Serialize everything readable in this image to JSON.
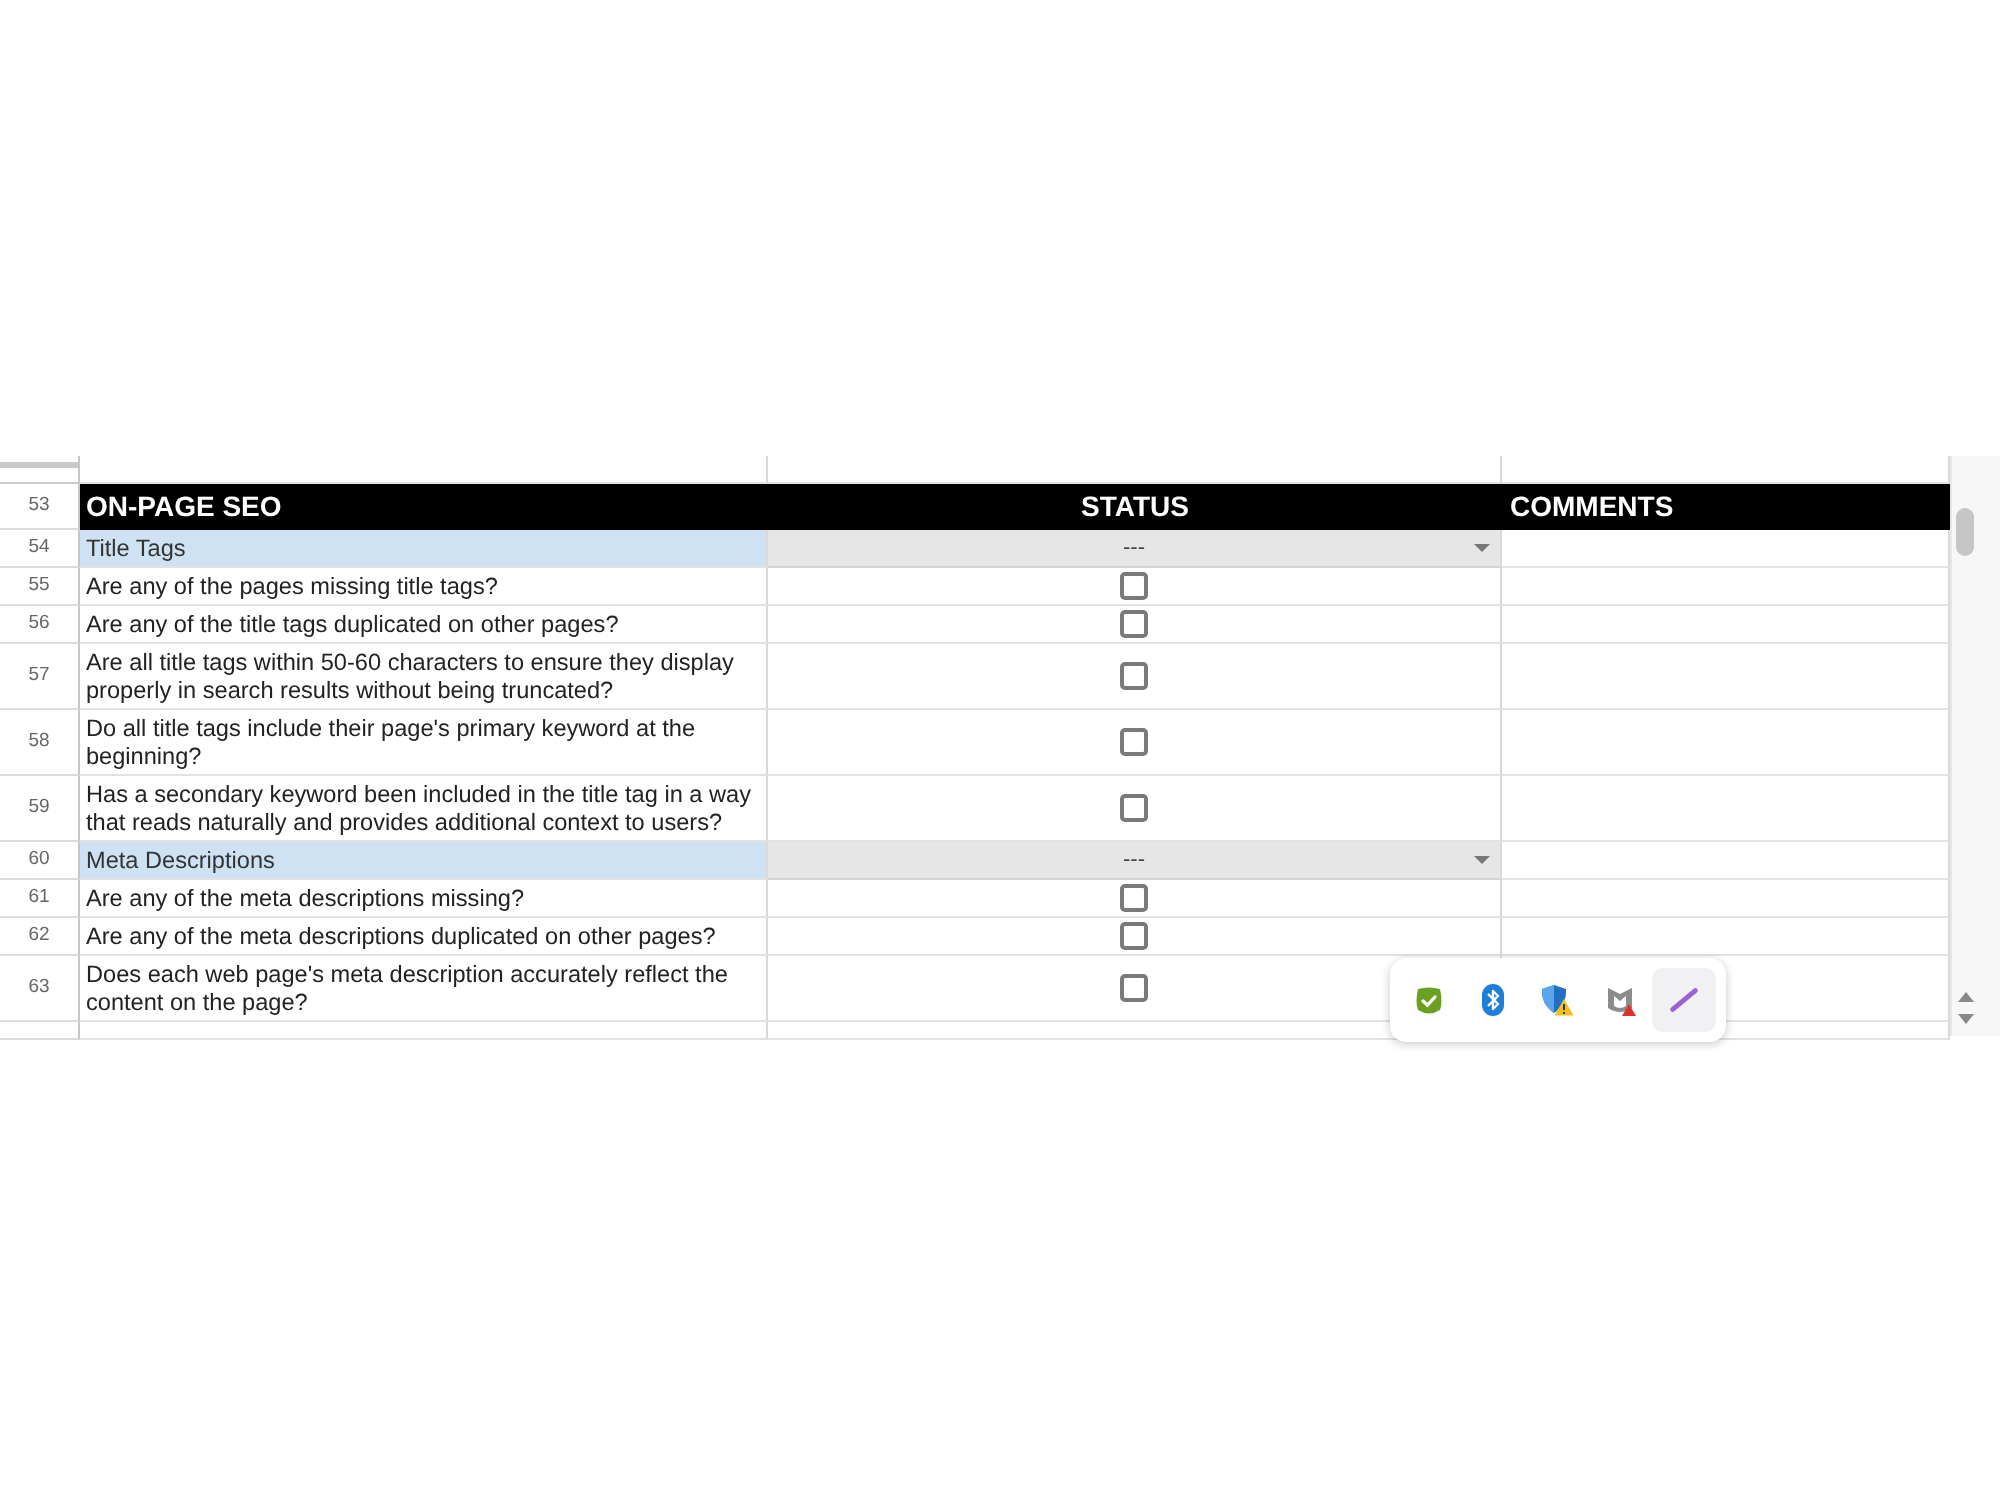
{
  "sheet": {
    "header": {
      "row_number": "53",
      "title": "ON-PAGE SEO",
      "status": "STATUS",
      "comments": "COMMENTS"
    },
    "rows": [
      {
        "row_number": "54",
        "kind": "section",
        "label": "Title Tags",
        "status": "---"
      },
      {
        "row_number": "55",
        "kind": "question",
        "text": "Are any of the pages missing title tags?",
        "checked": false
      },
      {
        "row_number": "56",
        "kind": "question",
        "text": "Are any of the title tags duplicated on other pages?",
        "checked": false
      },
      {
        "row_number": "57",
        "kind": "question",
        "text": "Are all title tags within 50-60 characters to ensure they display properly in search results without being truncated?",
        "checked": false
      },
      {
        "row_number": "58",
        "kind": "question",
        "text": "Do all title tags include their page's primary keyword at the beginning?",
        "checked": false
      },
      {
        "row_number": "59",
        "kind": "question",
        "text": "Has a secondary keyword been included in the title tag in a way that reads naturally and provides additional context to users?",
        "checked": false
      },
      {
        "row_number": "60",
        "kind": "section",
        "label": "Meta Descriptions",
        "status": "---"
      },
      {
        "row_number": "61",
        "kind": "question",
        "text": "Are any of the meta descriptions missing?",
        "checked": false
      },
      {
        "row_number": "62",
        "kind": "question",
        "text": "Are any of the meta descriptions duplicated on other pages?",
        "checked": false
      },
      {
        "row_number": "63",
        "kind": "question",
        "text": "Does each web page's meta description accurately reflect the content on the page?",
        "checked": false
      }
    ]
  },
  "tray": {
    "items": [
      {
        "kind": "shield-check",
        "selected": false
      },
      {
        "kind": "bluetooth",
        "selected": false
      },
      {
        "kind": "shield-warning",
        "selected": false
      },
      {
        "kind": "shield-badge",
        "selected": false
      },
      {
        "kind": "pen",
        "selected": true
      }
    ]
  }
}
